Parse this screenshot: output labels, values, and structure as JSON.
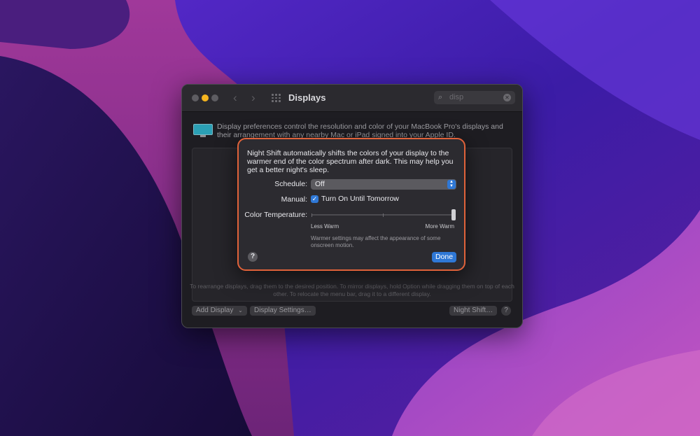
{
  "window": {
    "title": "Displays",
    "search_value": "disp",
    "description": "Display preferences control the resolution and color of your MacBook Pro's displays and their arrangement with any nearby Mac or iPad signed into your Apple ID.",
    "arrange_hint": "To rearrange displays, drag them to the desired position. To mirror displays, hold Option while dragging them on top of each other. To relocate the menu bar, drag it to a different display.",
    "buttons": {
      "add_display": "Add Display",
      "display_settings": "Display Settings…",
      "night_shift": "Night Shift…",
      "help": "?"
    }
  },
  "sheet": {
    "intro": "Night Shift automatically shifts the colors of your display to the warmer end of the color spectrum after dark. This may help you get a better night's sleep.",
    "schedule_label": "Schedule:",
    "schedule_value": "Off",
    "manual_label": "Manual:",
    "manual_checkbox_label": "Turn On Until Tomorrow",
    "manual_checked": true,
    "temperature_label": "Color Temperature:",
    "temperature_level": 1.0,
    "temperature_min": "Less Warm",
    "temperature_max": "More Warm",
    "note": "Warmer settings may affect the appearance of some onscreen motion.",
    "help": "?",
    "done": "Done"
  },
  "colors": {
    "highlight_border": "#e0623a",
    "accent": "#2f78d6",
    "minimize_light": "#f5b51f"
  }
}
